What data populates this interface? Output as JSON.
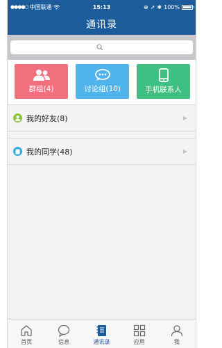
{
  "statusbar": {
    "carrier": "中国联通",
    "time": "15:13",
    "battery": "100%"
  },
  "navbar": {
    "title": "通讯录"
  },
  "search": {
    "placeholder": ""
  },
  "tiles": [
    {
      "label": "群组(4)",
      "icon": "group-icon",
      "color": "#f2707e"
    },
    {
      "label": "讨论组(10)",
      "icon": "chat-bubble-icon",
      "color": "#4fb3ec"
    },
    {
      "label": "手机联系人",
      "icon": "phone-icon",
      "color": "#3ec082"
    }
  ],
  "list": [
    {
      "label": "我的好友(8)",
      "icon": "friend-icon",
      "color": "#8dc63f"
    },
    {
      "label": "我的同学(48)",
      "icon": "classmate-icon",
      "color": "#33a9dc"
    }
  ],
  "tabbar": [
    {
      "label": "首页",
      "icon": "home-icon",
      "active": false
    },
    {
      "label": "信息",
      "icon": "message-icon",
      "active": false
    },
    {
      "label": "通讯录",
      "icon": "contacts-icon",
      "active": true
    },
    {
      "label": "应用",
      "icon": "apps-icon",
      "active": false
    },
    {
      "label": "我",
      "icon": "profile-icon",
      "active": false
    }
  ]
}
